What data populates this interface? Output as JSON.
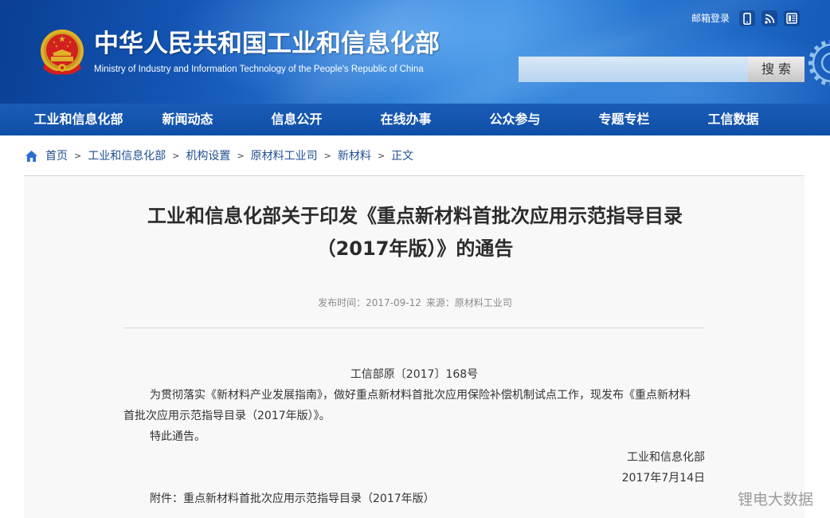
{
  "header": {
    "site_title": "中华人民共和国工业和信息化部",
    "site_subtitle": "Ministry of Industry and Information Technology of the People's Republic of China",
    "email_login": "邮箱登录",
    "icons": {
      "logo": "national-emblem-logo",
      "mobile": "mobile-icon",
      "rss": "rss-icon",
      "document": "document-icon",
      "decoration": "gear-icon"
    },
    "search": {
      "button_label": "搜 索"
    }
  },
  "nav": {
    "items": [
      "工业和信息化部",
      "新闻动态",
      "信息公开",
      "在线办事",
      "公众参与",
      "专题专栏",
      "工信数据"
    ]
  },
  "breadcrumb": {
    "home_icon": "home-icon",
    "separator": ">",
    "items": [
      "首页",
      "工业和信息化部",
      "机构设置",
      "原材料工业司",
      "新材料",
      "正文"
    ]
  },
  "article": {
    "title_lines": [
      "工业和信息化部关于印发《重点新材料首批次应用示范指导目录",
      "（2017年版）》的通告"
    ],
    "meta": {
      "publish_label": "发布时间：",
      "publish_date": "2017-09-12",
      "source_label": "来源：",
      "source": "原材料工业司"
    },
    "doc_number": "工信部原〔2017〕168号",
    "body_lines": [
      "为贯彻落实《新材料产业发展指南》，做好重点新材料首批次应用保险补偿机制试点工作，现发布《重点新材料",
      "首批次应用示范指导目录（2017年版）》。"
    ],
    "closing": "特此通告。",
    "signature_org": "工业和信息化部",
    "signature_date": "2017年7月14日",
    "attachment_label": "附件：",
    "attachment_title": "重点新材料首批次应用示范指导目录（2017年版）"
  },
  "watermark": "锂电大数据",
  "theme": {
    "header_blue": "#1558b8",
    "nav_blue": "#0f4fa8",
    "link_blue": "#1e4f91",
    "panel_gray": "#f8f8f8",
    "emblem_red": "#d21f1f",
    "emblem_gold": "#e0b02a"
  }
}
